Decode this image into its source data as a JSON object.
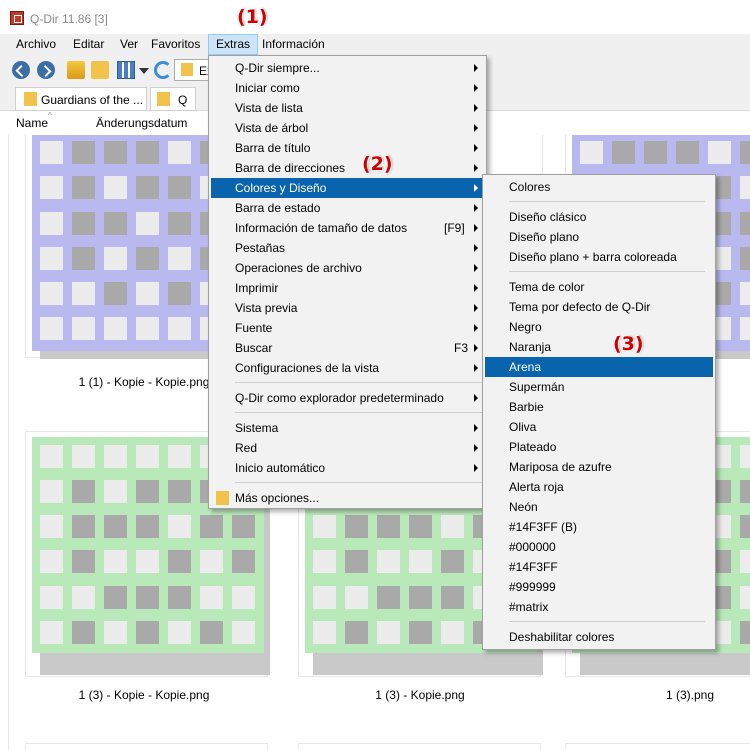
{
  "window": {
    "title": "Q-Dir 11.86 [3]"
  },
  "menubar": [
    "Archivo",
    "Editar",
    "Ver",
    "Favoritos",
    "Extras",
    "Información"
  ],
  "toolbar": {
    "address_partial": "Ex"
  },
  "tabs": [
    "Guardians of the ...",
    "Q"
  ],
  "columns": [
    "Name",
    "Änderungsdatum"
  ],
  "files": [
    "1 (1) - Kopie - Kopie.png",
    "1 (3) - Kopie - Kopie.png",
    "1 (3) - Kopie.png",
    "1 (3).png"
  ],
  "extras_menu": [
    {
      "label": "Q-Dir siempre...",
      "arrow": true
    },
    {
      "label": "Iniciar como",
      "arrow": true
    },
    {
      "label": "Vista de lista",
      "arrow": true
    },
    {
      "label": "Vista de árbol",
      "arrow": true
    },
    {
      "label": "Barra de título",
      "arrow": true
    },
    {
      "label": "Barra de direcciones",
      "arrow": true
    },
    {
      "label": "Colores y Diseño",
      "arrow": true,
      "highlighted": true
    },
    {
      "label": "Barra de estado",
      "arrow": true
    },
    {
      "label": "Información de tamaño de datos",
      "shortcut": "[F9]",
      "arrow": true
    },
    {
      "label": "Pestañas",
      "arrow": true
    },
    {
      "label": "Operaciones de archivo",
      "arrow": true
    },
    {
      "label": "Imprimir",
      "arrow": true
    },
    {
      "label": "Vista previa",
      "arrow": true
    },
    {
      "label": "Fuente",
      "arrow": true
    },
    {
      "label": "Buscar",
      "shortcut": "F3",
      "arrow": true
    },
    {
      "label": "Configuraciones de la vista",
      "arrow": true
    },
    {
      "label": "Q-Dir como explorador predeterminado",
      "arrow": true
    },
    {
      "label": "Sistema",
      "arrow": true
    },
    {
      "label": "Red",
      "arrow": true
    },
    {
      "label": "Inicio automático",
      "arrow": true
    },
    {
      "label": "Más opciones...",
      "icon": "folder-icon"
    }
  ],
  "colors_submenu": [
    "Colores",
    "Diseño clásico",
    "Diseño plano",
    "Diseño plano + barra coloreada",
    "Tema de color",
    "Tema por defecto de Q-Dir",
    "Negro",
    "Naranja",
    "Arena",
    "Supermán",
    "Barbie",
    "Oliva",
    "Plateado",
    "Mariposa de azufre",
    "Alerta roja",
    "Neón",
    "#14F3FF (B)",
    "#000000",
    "#14F3FF",
    "#999999",
    "#matrix",
    "Deshabilitar colores"
  ],
  "annotations": [
    "(1)",
    "(2)",
    "(3)"
  ],
  "colors": {
    "highlight": "#0a64ad",
    "menu_bg": "#f2f2f2",
    "annotation": "#d10000",
    "tile_blue": "#b9b9f0",
    "tile_green": "#b9e8b9",
    "tile_gray": "#a9a9a9",
    "tile_light": "#ececec"
  }
}
